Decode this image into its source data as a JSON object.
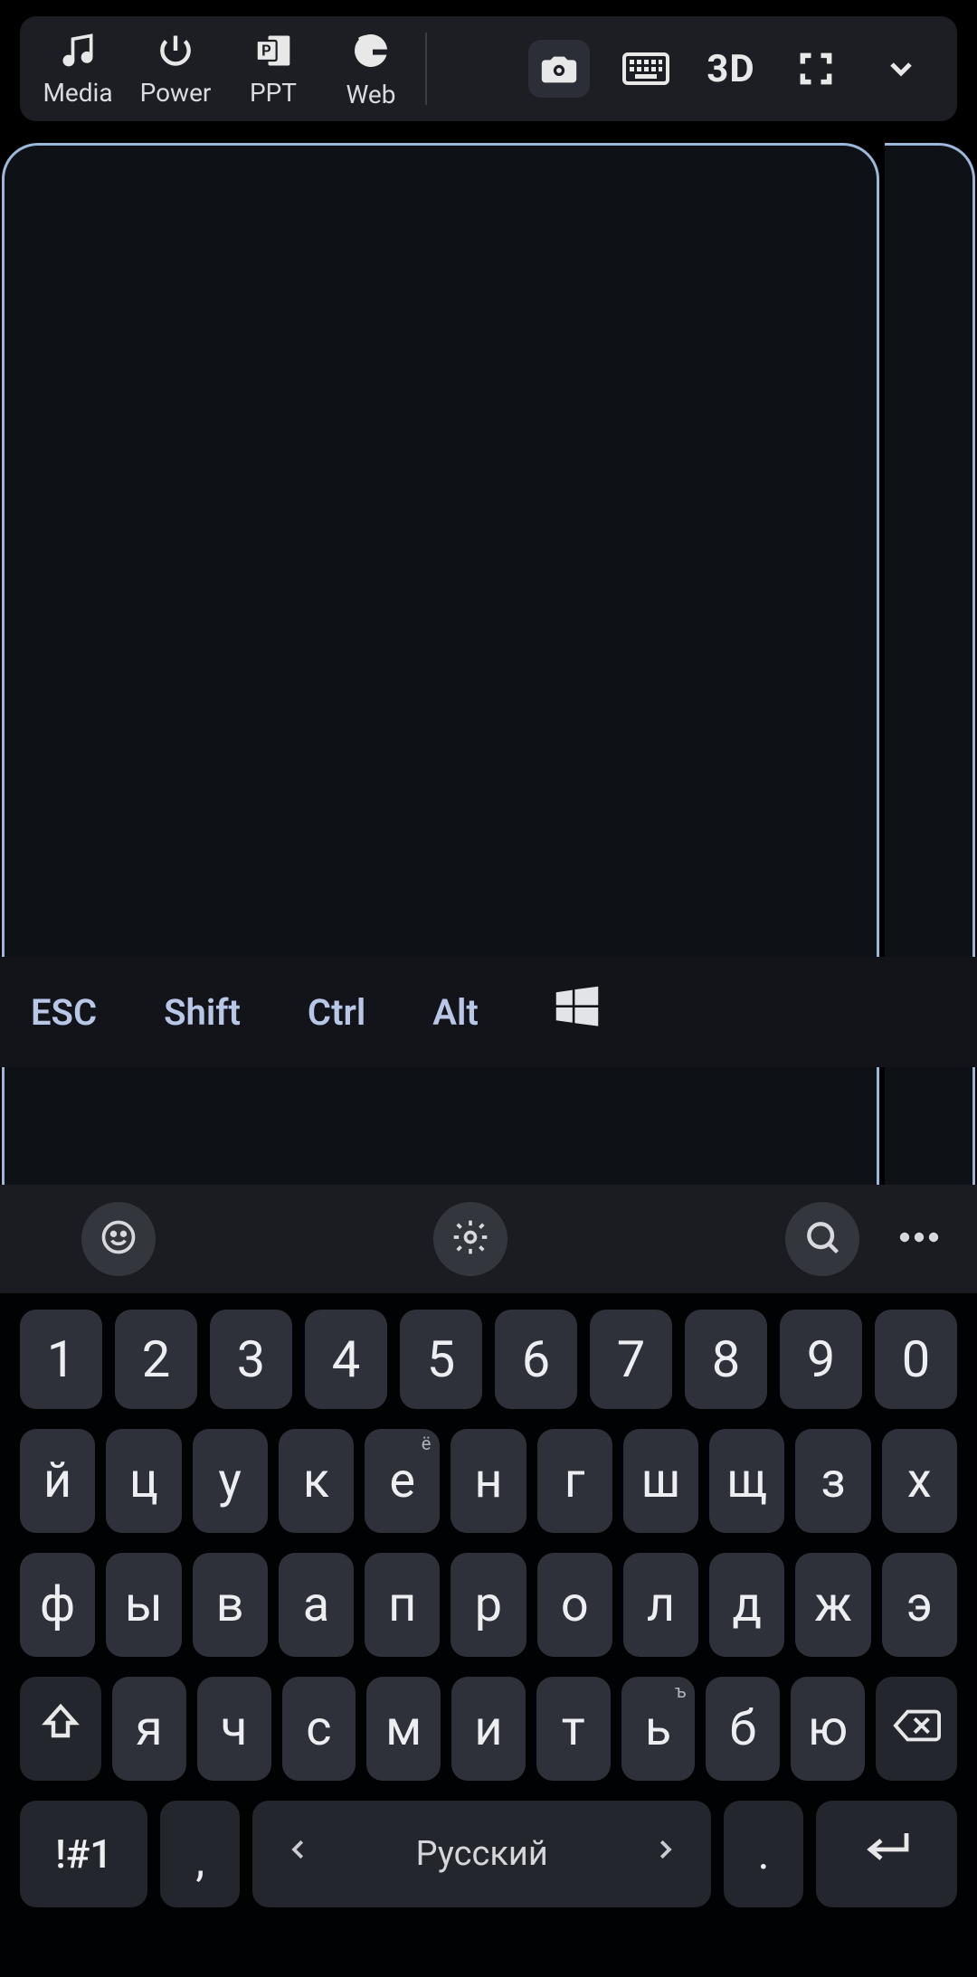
{
  "topbar": {
    "modes": [
      {
        "id": "media",
        "label": "Media"
      },
      {
        "id": "power",
        "label": "Power"
      },
      {
        "id": "ppt",
        "label": "PPT"
      },
      {
        "id": "web",
        "label": "Web"
      }
    ],
    "right": {
      "camera": "camera",
      "keyboard": "keyboard",
      "label3d": "3D",
      "fullscreen": "fullscreen",
      "expand": "expand"
    }
  },
  "modifiers": {
    "esc": "ESC",
    "shift": "Shift",
    "ctrl": "Ctrl",
    "alt": "Alt",
    "win": "Windows"
  },
  "keyboard": {
    "toolbar": {
      "emoji": "emoji",
      "settings": "settings",
      "search": "search",
      "more": "more"
    },
    "row_nums": [
      "1",
      "2",
      "3",
      "4",
      "5",
      "6",
      "7",
      "8",
      "9",
      "0"
    ],
    "row1": [
      "й",
      "ц",
      "у",
      "к",
      "е",
      "н",
      "г",
      "ш",
      "щ",
      "з",
      "х"
    ],
    "row1_sup": {
      "4": "ё"
    },
    "row2": [
      "ф",
      "ы",
      "в",
      "а",
      "п",
      "р",
      "о",
      "л",
      "д",
      "ж",
      "э"
    ],
    "row3": [
      "я",
      "ч",
      "с",
      "м",
      "и",
      "т",
      "ь",
      "б",
      "ю"
    ],
    "row3_sup": {
      "6": "ъ"
    },
    "bottom": {
      "symnum": "!#1",
      "comma": ",",
      "space_lang": "Русский",
      "period": "."
    }
  }
}
